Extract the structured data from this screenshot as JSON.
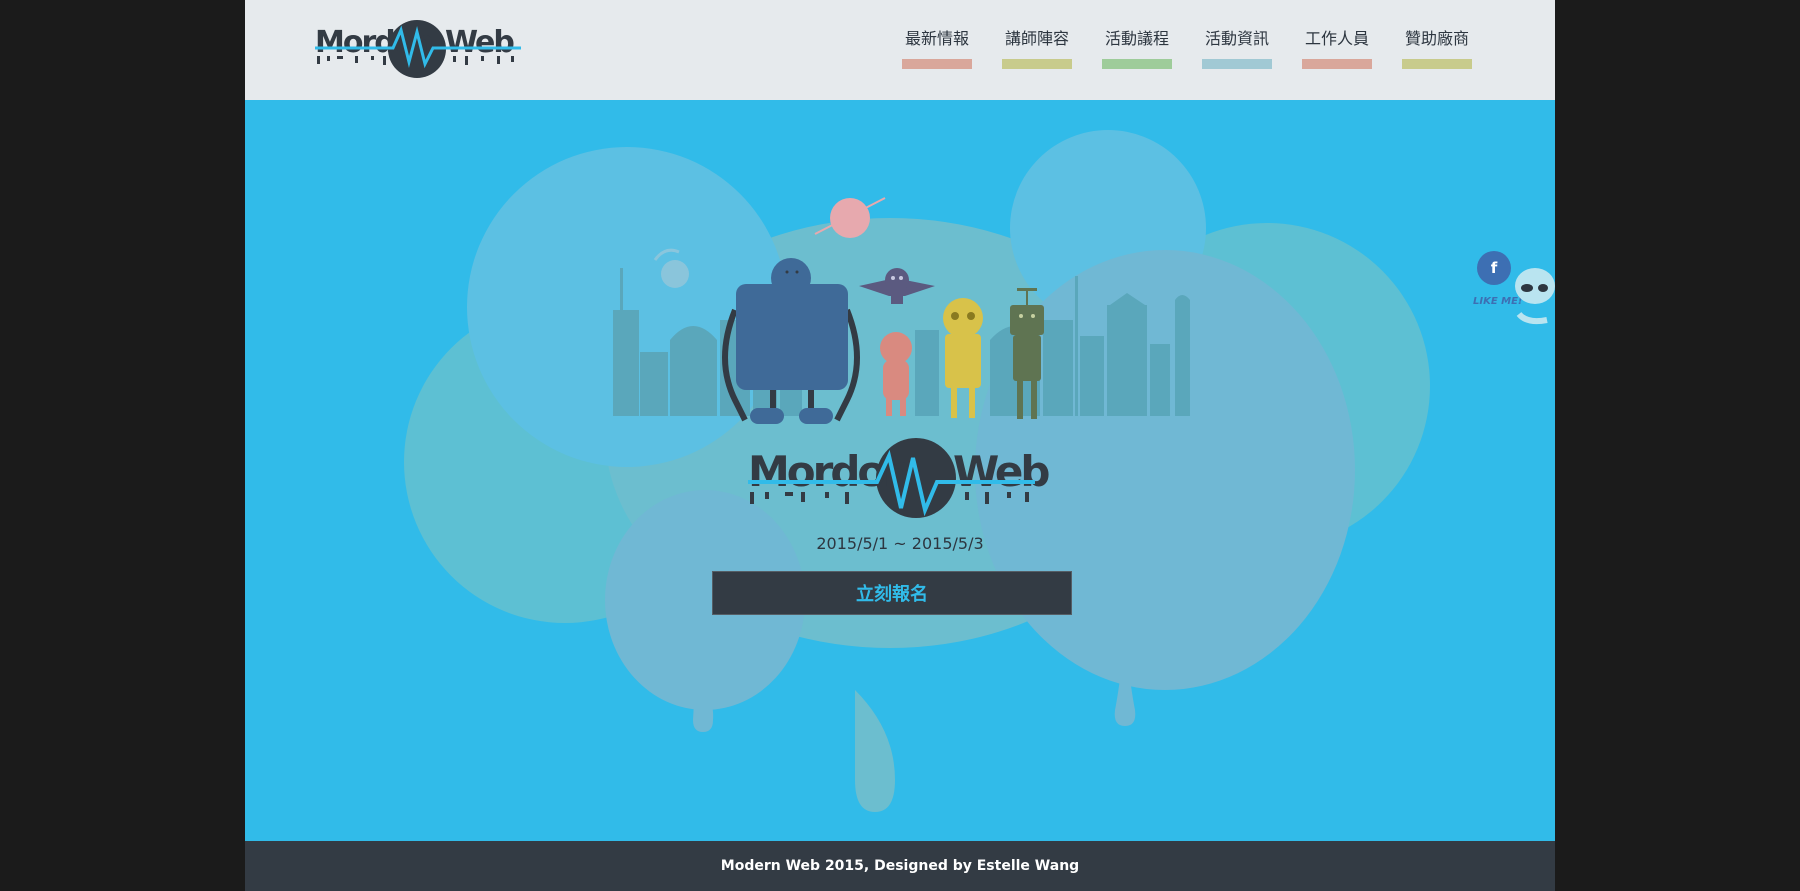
{
  "header": {
    "logo_alt": "Mordon Web"
  },
  "nav": {
    "items": [
      {
        "label": "最新情報",
        "color": "#d9a79b"
      },
      {
        "label": "講師陣容",
        "color": "#c8cb8c"
      },
      {
        "label": "活動議程",
        "color": "#9ecc9a"
      },
      {
        "label": "活動資訊",
        "color": "#a1c9d4"
      },
      {
        "label": "工作人員",
        "color": "#d9a79b"
      },
      {
        "label": "贊助廠商",
        "color": "#c8cb8c"
      }
    ]
  },
  "hero": {
    "logo_text_left": "Mordon",
    "logo_text_right": "Web",
    "date": "2015/5/1 ~ 2015/5/3",
    "register_label": "立刻報名"
  },
  "social": {
    "facebook_icon": "facebook-icon",
    "like_text": "LIKE ME!"
  },
  "footer": {
    "text": "Modern Web 2015, Designed by Estelle Wang"
  },
  "colors": {
    "accent": "#31bbe9",
    "dark": "#333b44",
    "header_bg": "#e6eaed"
  }
}
